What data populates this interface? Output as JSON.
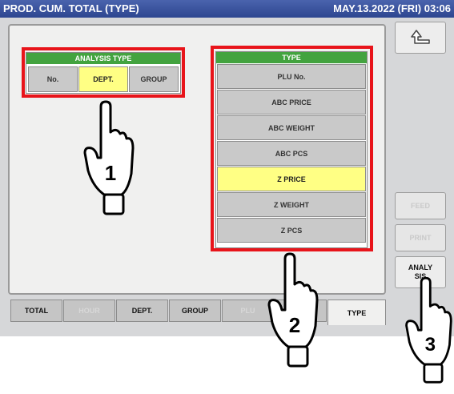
{
  "header": {
    "title": "PROD. CUM. TOTAL (TYPE)",
    "datetime": "MAY.13.2022 (FRI) 03:06"
  },
  "analysis_type": {
    "title": "ANALYSIS TYPE",
    "options": [
      "No.",
      "DEPT.",
      "GROUP"
    ],
    "selected": "DEPT."
  },
  "type_list": {
    "title": "TYPE",
    "options": [
      "PLU No.",
      "ABC PRICE",
      "ABC WEIGHT",
      "ABC PCS",
      "Z PRICE",
      "Z WEIGHT",
      "Z PCS"
    ],
    "selected": "Z PRICE"
  },
  "side_buttons": {
    "back_icon": "return-arrow-icon",
    "feed": "FEED",
    "print": "PRINT",
    "analysis": "ANALY\nSIS"
  },
  "tabs": [
    "TOTAL",
    "HOUR",
    "DEPT.",
    "GROUP",
    "PLU",
    "",
    "TYPE"
  ],
  "callouts": [
    "1",
    "2",
    "3"
  ],
  "colors": {
    "title_bar": "#2d4690",
    "header_green": "#43a33f",
    "selected": "#ffff84",
    "highlight_red": "#e8141a"
  }
}
